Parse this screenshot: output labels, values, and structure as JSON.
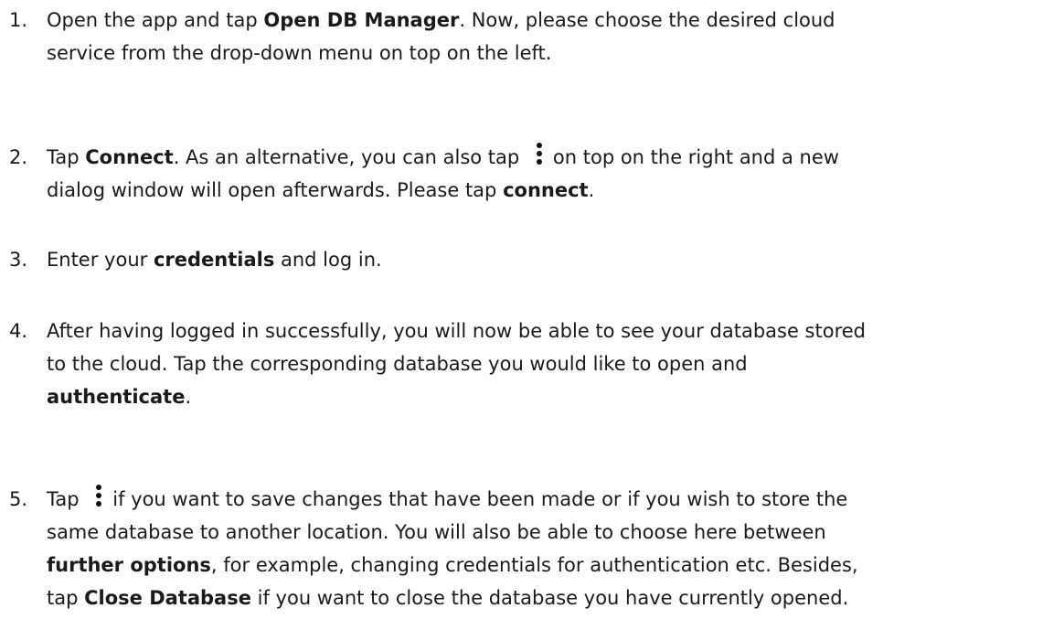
{
  "steps": [
    {
      "number": "1.",
      "lines": [
        [
          "Open the app and tap ",
          "Open DB Manager",
          ". Now, please choose the desired cloud"
        ],
        [
          "service from the drop-down menu on top on the left."
        ]
      ]
    },
    {
      "number": "2.",
      "lines": [
        [
          "Tap ",
          "Connect",
          ". As an alternative, you can also tap ",
          "on top on the right and a new"
        ],
        [
          "dialog window will open afterwards. Please tap ",
          "connect",
          "."
        ]
      ]
    },
    {
      "number": "3.",
      "lines": [
        [
          "Enter your ",
          "credentials",
          " and log in."
        ]
      ]
    },
    {
      "number": "4.",
      "lines": [
        [
          "After having logged in successfully, you will now be able to see your database stored"
        ],
        [
          "to the cloud. Tap the corresponding database you would like to open and"
        ],
        [
          "authenticate",
          "."
        ]
      ]
    },
    {
      "number": "5.",
      "lines": [
        [
          "Tap ",
          "if you want to save changes that have been made or if you wish to store the"
        ],
        [
          "same database to another location. You will also be able to choose here between"
        ],
        [
          "further options",
          ", for example, changing credentials for authentication etc. Besides,"
        ],
        [
          "tap ",
          "Close Database",
          " if you want to close the database you have currently opened."
        ]
      ]
    }
  ],
  "icons": {
    "menu": "more-vertical-icon"
  }
}
